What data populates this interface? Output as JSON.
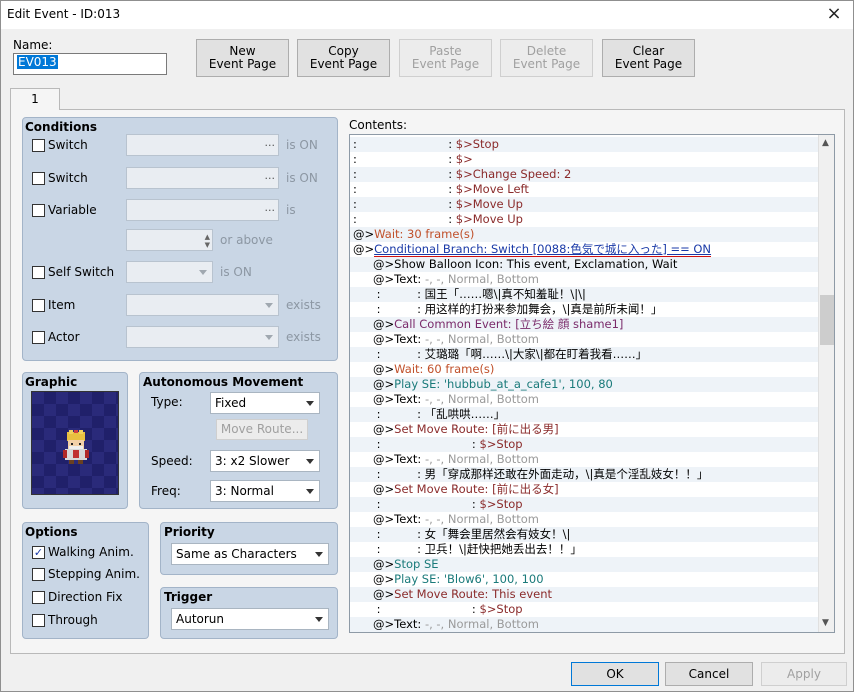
{
  "window": {
    "title": "Edit Event - ID:013",
    "close": "×"
  },
  "name": {
    "label": "Name:",
    "value": "EV013"
  },
  "toolbar": [
    {
      "label": "New\nEvent Page",
      "enabled": true
    },
    {
      "label": "Copy\nEvent Page",
      "enabled": true
    },
    {
      "label": "Paste\nEvent Page",
      "enabled": false
    },
    {
      "label": "Delete\nEvent Page",
      "enabled": false
    },
    {
      "label": "Clear\nEvent Page",
      "enabled": true
    }
  ],
  "tab": "1",
  "conditions": {
    "title": "Conditions",
    "switch1": {
      "label": "Switch",
      "suffix": "is ON",
      "dots": "..."
    },
    "switch2": {
      "label": "Switch",
      "suffix": "is ON",
      "dots": "..."
    },
    "variable": {
      "label": "Variable",
      "suffix": "is",
      "dots": "...",
      "or_above": "or above"
    },
    "self_switch": {
      "label": "Self Switch",
      "suffix": "is ON"
    },
    "item": {
      "label": "Item",
      "suffix": "exists"
    },
    "actor": {
      "label": "Actor",
      "suffix": "exists"
    }
  },
  "graphic": {
    "title": "Graphic"
  },
  "autonomous": {
    "title": "Autonomous Movement",
    "type_label": "Type:",
    "type_value": "Fixed",
    "move_route": "Move Route...",
    "speed_label": "Speed:",
    "speed_value": "3: x2 Slower",
    "freq_label": "Freq:",
    "freq_value": "3: Normal"
  },
  "options": {
    "title": "Options",
    "items": [
      {
        "label": "Walking Anim.",
        "checked": true,
        "mark": "✓"
      },
      {
        "label": "Stepping Anim.",
        "checked": false,
        "mark": ""
      },
      {
        "label": "Direction Fix",
        "checked": false,
        "mark": ""
      },
      {
        "label": "Through",
        "checked": false,
        "mark": ""
      }
    ]
  },
  "priority": {
    "title": "Priority",
    "value": "Same as Characters"
  },
  "trigger": {
    "title": "Trigger",
    "value": "Autorun"
  },
  "contents": {
    "label": "Contents:",
    "scroll_up": "▲",
    "scroll_down": "▼",
    "lines": [
      {
        "parts": [
          {
            "t": ":                         : ",
            "c": "black"
          },
          {
            "t": "$>Stop",
            "c": "maroon"
          }
        ]
      },
      {
        "parts": [
          {
            "t": ":                         : ",
            "c": "black"
          },
          {
            "t": "$>",
            "c": "maroon"
          }
        ]
      },
      {
        "parts": [
          {
            "t": ":                         : ",
            "c": "black"
          },
          {
            "t": "$>Change Speed: 2",
            "c": "maroon"
          }
        ]
      },
      {
        "parts": [
          {
            "t": ":                         : ",
            "c": "black"
          },
          {
            "t": "$>Move Left",
            "c": "maroon"
          }
        ]
      },
      {
        "parts": [
          {
            "t": ":                         : ",
            "c": "black"
          },
          {
            "t": "$>Move Up",
            "c": "maroon"
          }
        ]
      },
      {
        "parts": [
          {
            "t": ":                         : ",
            "c": "black"
          },
          {
            "t": "$>Move Up",
            "c": "maroon"
          }
        ]
      },
      {
        "parts": [
          {
            "t": "@>",
            "c": "black"
          },
          {
            "t": "Wait: 30 frame(s)",
            "c": "orange"
          }
        ]
      },
      {
        "parts": [
          {
            "t": "@>",
            "c": "black"
          },
          {
            "t": "Conditional Branch: Switch [0088:色気で城に入った] == ON",
            "c": "blue"
          }
        ],
        "underline": true
      },
      {
        "indent": 1,
        "parts": [
          {
            "t": "@>",
            "c": "black"
          },
          {
            "t": "Show Balloon Icon: This event, Exclamation, Wait",
            "c": "black"
          }
        ]
      },
      {
        "indent": 1,
        "parts": [
          {
            "t": "@>Text: ",
            "c": "black"
          },
          {
            "t": "-, -, Normal, Bottom",
            "c": "gray"
          }
        ]
      },
      {
        "indent": 1,
        "parts": [
          {
            "t": " :          : ",
            "c": "black"
          },
          {
            "t": "国王「……嗯\\|真不知羞耻！\\|\\|",
            "c": "black"
          }
        ]
      },
      {
        "indent": 1,
        "parts": [
          {
            "t": " :          : ",
            "c": "black"
          },
          {
            "t": "用这样的打扮来参加舞会，\\|真是前所未闻！」",
            "c": "black"
          }
        ]
      },
      {
        "indent": 1,
        "parts": [
          {
            "t": "@>",
            "c": "black"
          },
          {
            "t": "Call Common Event: [立ち絵 顔 shame1]",
            "c": "purple"
          }
        ]
      },
      {
        "indent": 1,
        "parts": [
          {
            "t": "@>Text: ",
            "c": "black"
          },
          {
            "t": "-, -, Normal, Bottom",
            "c": "gray"
          }
        ]
      },
      {
        "indent": 1,
        "parts": [
          {
            "t": " :          : ",
            "c": "black"
          },
          {
            "t": "艾璐璐「啊……\\|大家\\|都在盯着我看……」",
            "c": "black"
          }
        ]
      },
      {
        "indent": 1,
        "parts": [
          {
            "t": "@>",
            "c": "black"
          },
          {
            "t": "Wait: 60 frame(s)",
            "c": "orange"
          }
        ]
      },
      {
        "indent": 1,
        "parts": [
          {
            "t": "@>",
            "c": "black"
          },
          {
            "t": "Play SE: 'hubbub_at_a_cafe1', 100, 80",
            "c": "teal"
          }
        ]
      },
      {
        "indent": 1,
        "parts": [
          {
            "t": "@>Text: ",
            "c": "black"
          },
          {
            "t": "-, -, Normal, Bottom",
            "c": "gray"
          }
        ]
      },
      {
        "indent": 1,
        "parts": [
          {
            "t": " :          : ",
            "c": "black"
          },
          {
            "t": "「乱哄哄……」",
            "c": "black"
          }
        ]
      },
      {
        "indent": 1,
        "parts": [
          {
            "t": "@>",
            "c": "black"
          },
          {
            "t": "Set Move Route: [前に出る男]",
            "c": "maroon"
          }
        ]
      },
      {
        "indent": 1,
        "parts": [
          {
            "t": " :                         : ",
            "c": "black"
          },
          {
            "t": "$>Stop",
            "c": "maroon"
          }
        ]
      },
      {
        "indent": 1,
        "parts": [
          {
            "t": "@>Text: ",
            "c": "black"
          },
          {
            "t": "-, -, Normal, Bottom",
            "c": "gray"
          }
        ]
      },
      {
        "indent": 1,
        "parts": [
          {
            "t": " :          : ",
            "c": "black"
          },
          {
            "t": "男「穿成那样还敢在外面走动，\\|真是个淫乱妓女！！」",
            "c": "black"
          }
        ]
      },
      {
        "indent": 1,
        "parts": [
          {
            "t": "@>",
            "c": "black"
          },
          {
            "t": "Set Move Route: [前に出る女]",
            "c": "maroon"
          }
        ]
      },
      {
        "indent": 1,
        "parts": [
          {
            "t": " :                         : ",
            "c": "black"
          },
          {
            "t": "$>Stop",
            "c": "maroon"
          }
        ]
      },
      {
        "indent": 1,
        "parts": [
          {
            "t": "@>Text: ",
            "c": "black"
          },
          {
            "t": "-, -, Normal, Bottom",
            "c": "gray"
          }
        ]
      },
      {
        "indent": 1,
        "parts": [
          {
            "t": " :          : ",
            "c": "black"
          },
          {
            "t": "女「舞会里居然会有妓女！\\|",
            "c": "black"
          }
        ]
      },
      {
        "indent": 1,
        "parts": [
          {
            "t": " :          : ",
            "c": "black"
          },
          {
            "t": "卫兵！\\|赶快把她丢出去！！」",
            "c": "black"
          }
        ]
      },
      {
        "indent": 1,
        "parts": [
          {
            "t": "@>",
            "c": "black"
          },
          {
            "t": "Stop SE",
            "c": "teal"
          }
        ]
      },
      {
        "indent": 1,
        "parts": [
          {
            "t": "@>",
            "c": "black"
          },
          {
            "t": "Play SE: 'Blow6', 100, 100",
            "c": "teal"
          }
        ]
      },
      {
        "indent": 1,
        "parts": [
          {
            "t": "@>",
            "c": "black"
          },
          {
            "t": "Set Move Route: This event",
            "c": "maroon"
          }
        ]
      },
      {
        "indent": 1,
        "parts": [
          {
            "t": " :                         : ",
            "c": "black"
          },
          {
            "t": "$>Stop",
            "c": "maroon"
          }
        ]
      },
      {
        "indent": 1,
        "parts": [
          {
            "t": "@>Text: ",
            "c": "black"
          },
          {
            "t": "-, -, Normal, Bottom",
            "c": "gray"
          }
        ]
      }
    ]
  },
  "footer": {
    "ok": "OK",
    "cancel": "Cancel",
    "apply": "Apply"
  }
}
